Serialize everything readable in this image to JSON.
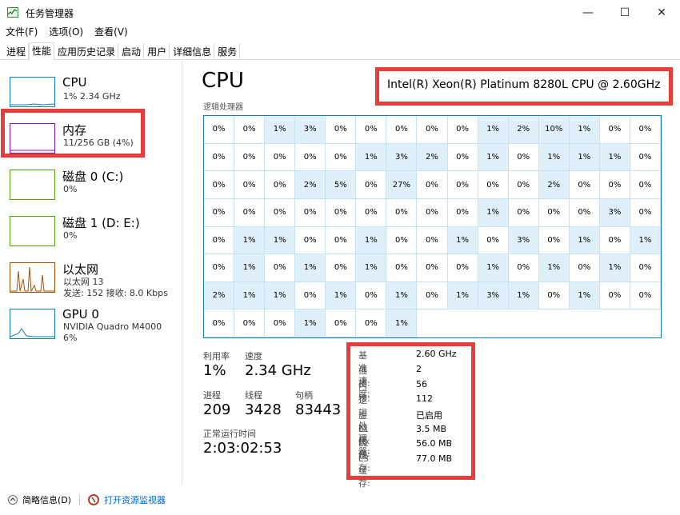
{
  "window": {
    "title": "任务管理器",
    "controls": [
      "—",
      "☐",
      "✕"
    ]
  },
  "menu": [
    "文件(F)",
    "选项(O)",
    "查看(V)"
  ],
  "tabs": [
    "进程",
    "性能",
    "应用历史记录",
    "启动",
    "用户",
    "详细信息",
    "服务"
  ],
  "sidebar": [
    {
      "title": "CPU",
      "sub1": "1% 2.34 GHz",
      "sub2": "",
      "color": "#117dbb"
    },
    {
      "title": "内存",
      "sub1": "11/256 GB (4%)",
      "sub2": "",
      "color": "#8b12ae"
    },
    {
      "title": "磁盘 0 (C:)",
      "sub1": "0%",
      "sub2": "",
      "color": "#4da60c"
    },
    {
      "title": "磁盘 1 (D: E:)",
      "sub1": "0%",
      "sub2": "",
      "color": "#4da60c"
    },
    {
      "title": "以太网",
      "sub1": "以太网 13",
      "sub2": "发送: 152 接收: 8.0 Kbps",
      "color": "#a74f01"
    },
    {
      "title": "GPU 0",
      "sub1": "NVIDIA Quadro M4000",
      "sub2": "6%",
      "color": "#117dbb"
    }
  ],
  "main": {
    "title": "CPU",
    "model": "Intel(R) Xeon(R) Platinum 8280L CPU @ 2.60GHz",
    "grid_label": "逻辑处理器",
    "cells": [
      [
        "0%",
        "0%",
        "1%",
        "3%",
        "0%",
        "0%",
        "0%",
        "0%",
        "0%",
        "1%",
        "2%",
        "10%",
        "1%",
        "0%",
        "0%"
      ],
      [
        "0%",
        "0%",
        "0%",
        "0%",
        "0%",
        "1%",
        "3%",
        "2%",
        "0%",
        "1%",
        "0%",
        "1%",
        "1%",
        "1%",
        "0%"
      ],
      [
        "0%",
        "0%",
        "0%",
        "2%",
        "5%",
        "0%",
        "27%",
        "0%",
        "0%",
        "0%",
        "0%",
        "2%",
        "0%",
        "0%",
        "0%"
      ],
      [
        "0%",
        "0%",
        "0%",
        "0%",
        "0%",
        "0%",
        "0%",
        "0%",
        "0%",
        "1%",
        "0%",
        "0%",
        "0%",
        "3%",
        "0%"
      ],
      [
        "0%",
        "1%",
        "1%",
        "0%",
        "0%",
        "1%",
        "0%",
        "0%",
        "1%",
        "0%",
        "3%",
        "0%",
        "1%",
        "0%",
        "1%"
      ],
      [
        "0%",
        "1%",
        "0%",
        "1%",
        "0%",
        "1%",
        "0%",
        "0%",
        "0%",
        "1%",
        "0%",
        "1%",
        "0%",
        "1%",
        "0%"
      ],
      [
        "2%",
        "1%",
        "1%",
        "0%",
        "1%",
        "0%",
        "1%",
        "0%",
        "1%",
        "3%",
        "1%",
        "0%",
        "1%",
        "0%",
        "0%"
      ],
      [
        "0%",
        "0%",
        "0%",
        "1%",
        "0%",
        "0%",
        "1%"
      ]
    ],
    "highlight": [
      [
        0,
        0,
        1,
        1,
        0,
        0,
        0,
        0,
        0,
        1,
        1,
        1,
        1,
        0,
        0
      ],
      [
        0,
        0,
        0,
        0,
        0,
        1,
        1,
        1,
        0,
        1,
        0,
        1,
        1,
        1,
        0
      ],
      [
        0,
        0,
        0,
        1,
        1,
        0,
        1,
        0,
        0,
        0,
        0,
        1,
        0,
        0,
        0
      ],
      [
        0,
        0,
        0,
        0,
        0,
        0,
        0,
        0,
        0,
        1,
        0,
        0,
        0,
        1,
        0
      ],
      [
        0,
        1,
        1,
        0,
        0,
        1,
        0,
        0,
        1,
        0,
        1,
        0,
        1,
        0,
        1
      ],
      [
        0,
        1,
        0,
        1,
        0,
        1,
        0,
        0,
        0,
        1,
        0,
        1,
        0,
        1,
        0
      ],
      [
        1,
        1,
        1,
        0,
        1,
        0,
        1,
        0,
        1,
        1,
        1,
        0,
        1,
        0,
        0
      ],
      [
        0,
        0,
        0,
        1,
        0,
        0,
        1
      ]
    ],
    "stats": {
      "util_label": "利用率",
      "util_value": "1%",
      "speed_label": "速度",
      "speed_value": "2.34 GHz",
      "proc_label": "进程",
      "proc_value": "209",
      "thread_label": "线程",
      "thread_value": "3428",
      "handle_label": "句柄",
      "handle_value": "83443",
      "uptime_label": "正常运行时间",
      "uptime_value": "2:03:02:53"
    },
    "details": [
      {
        "key": "基准速度:",
        "val": "2.60 GHz"
      },
      {
        "key": "插槽:",
        "val": "2"
      },
      {
        "key": "内核:",
        "val": "56"
      },
      {
        "key": "逻辑处理器:",
        "val": "112"
      },
      {
        "key": "虚拟化:",
        "val": "已启用"
      },
      {
        "key": "L1 缓存:",
        "val": "3.5 MB"
      },
      {
        "key": "L2 缓存:",
        "val": "56.0 MB"
      },
      {
        "key": "L3 缓存:",
        "val": "77.0 MB"
      }
    ]
  },
  "footer": {
    "summary": "简略信息(D)",
    "resmon": "打开资源监视器"
  },
  "colors": {
    "highlight": "#e73c3c",
    "cpu": "#117dbb",
    "memory": "#8b12ae",
    "disk": "#4da60c",
    "ethernet": "#a74f01"
  }
}
